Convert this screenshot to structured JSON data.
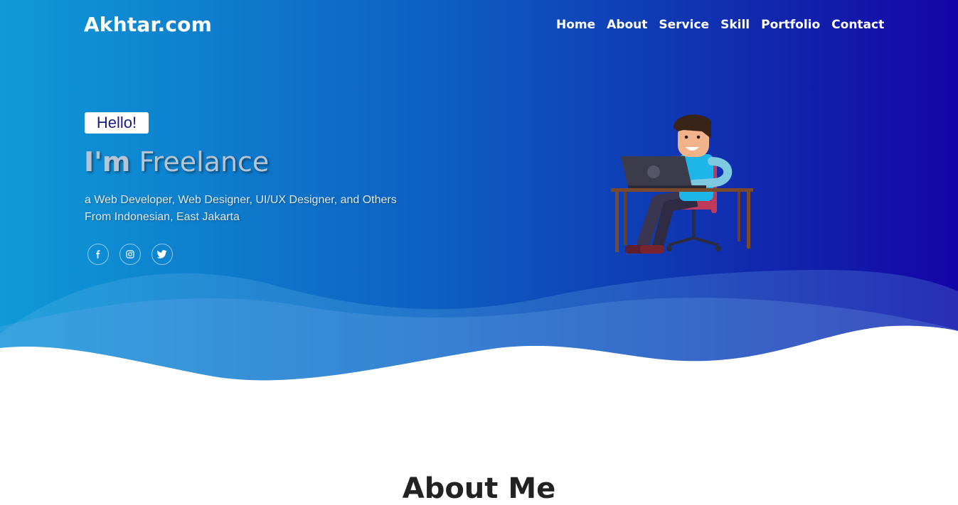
{
  "brand": "Akhtar.com",
  "nav": [
    "Home",
    "About",
    "Service",
    "Skill",
    "Portfolio",
    "Contact"
  ],
  "hero": {
    "badge": "Hello!",
    "headline_strong": "I'm",
    "headline_rest": "Freelance",
    "description": [
      "a Web Developer, Web Designer, UI/UX Designer, and Others",
      "From Indonesian, East Jakarta"
    ],
    "socials": [
      "facebook-icon",
      "instagram-icon",
      "twitter-icon"
    ],
    "illustration": "developer-at-desk-illustration"
  },
  "about": {
    "title": "About Me"
  },
  "colors": {
    "gradient_start": "#0f9ad8",
    "gradient_end": "#1405a6",
    "badge_text": "#1a1a8c",
    "white": "#ffffff"
  }
}
